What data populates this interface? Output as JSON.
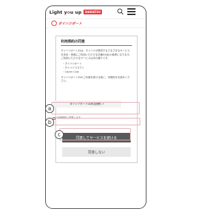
{
  "header": {
    "brand_main": "Light y",
    "brand_o": "o",
    "brand_rest": "u up",
    "brand_badge": "DAIHATSU"
  },
  "subheader": {
    "logo_text": "ダイハツポート"
  },
  "terms": {
    "title": "利用規約の同意",
    "intro": "ダイハツポートIDは、ダイハツが提供するさまざまなサービスを安全・快適にご利用いただける共通ID(仮)の総称になります。",
    "services_lead": "ご利用いただけるサービスは次の通りです。",
    "services": [
      "ダイハツポート",
      "ダイハツコネクト",
      "Capen Club"
    ],
    "closing": "ダイハツポートIDのご利用を続ける前に、本規約をお読みください。"
  },
  "tos_link": "ダイハツポートID利用規約 ↗",
  "agree_checkbox_label": "利用規約に同意します",
  "buttons": {
    "agree": "同意してサービスを続ける",
    "decline": "同意しない"
  },
  "markers": {
    "a": "a",
    "b": "b",
    "c": "c"
  },
  "colors": {
    "accent": "#e8383d",
    "callout": "#e3b0b8",
    "primary_button": "#595959"
  }
}
